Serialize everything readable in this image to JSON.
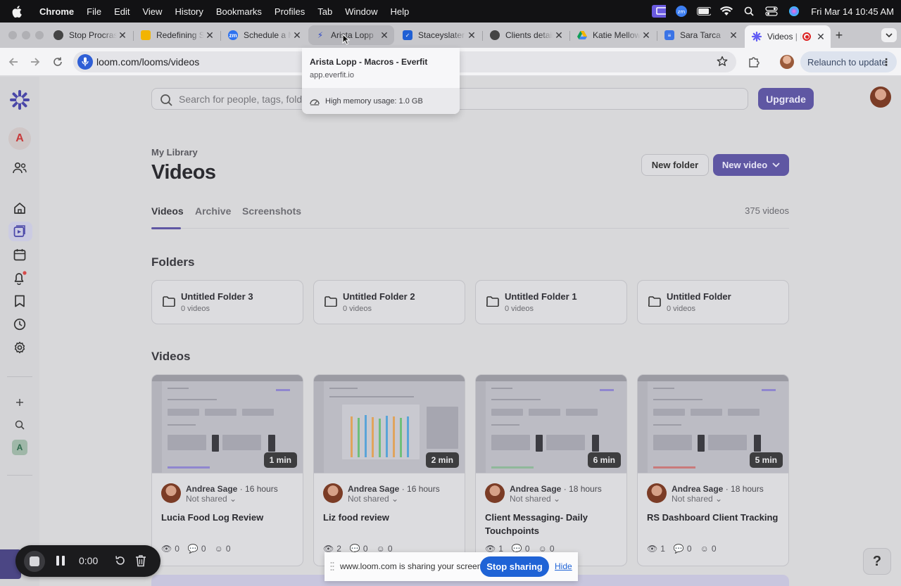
{
  "menubar": {
    "app": "Chrome",
    "items": [
      "File",
      "Edit",
      "View",
      "History",
      "Bookmarks",
      "Profiles",
      "Tab",
      "Window",
      "Help"
    ],
    "clock": "Fri Mar 14  10:45 AM"
  },
  "browser": {
    "tabs": [
      {
        "label": "Stop Procrastinating",
        "favicon": "circle-logo-icon"
      },
      {
        "label": "Redefining Success",
        "favicon": "slides-icon"
      },
      {
        "label": "Schedule a Meeting",
        "favicon": "zoom-icon"
      },
      {
        "label": "Arista Lopp",
        "favicon": "everfit-icon"
      },
      {
        "label": "Staceyslater",
        "favicon": "jira-icon"
      },
      {
        "label": "Clients details",
        "favicon": "circle-logo-icon"
      },
      {
        "label": "Katie Mellow",
        "favicon": "drive-icon"
      },
      {
        "label": "Sara Tarca",
        "favicon": "docs-icon"
      },
      {
        "label": "Videos | Loom",
        "favicon": "loom-icon"
      }
    ],
    "url": "loom.com/looms/videos",
    "relaunch_label": "Relaunch to update"
  },
  "hovercard": {
    "title": "Arista Lopp - Macros - Everfit",
    "host": "app.everfit.io",
    "memory": "High memory usage: 1.0 GB"
  },
  "loom": {
    "search_placeholder": "Search for people, tags, folders, spaces, and Looms",
    "upgrade_label": "Upgrade",
    "workspace_initial": "A",
    "library_label": "My Library",
    "title": "Videos",
    "new_folder_label": "New folder",
    "new_video_label": "New video",
    "tabs": [
      "Videos",
      "Archive",
      "Screenshots"
    ],
    "video_count": "375 videos",
    "folders_heading": "Folders",
    "folders": [
      {
        "name": "Untitled Folder 3",
        "count": "0 videos"
      },
      {
        "name": "Untitled Folder 2",
        "count": "0 videos"
      },
      {
        "name": "Untitled Folder 1",
        "count": "0 videos"
      },
      {
        "name": "Untitled Folder",
        "count": "0 videos"
      }
    ],
    "videos_heading": "Videos",
    "videos": [
      {
        "title": "Lucia Food Log Review",
        "author": "Andrea Sage",
        "age": "16 hours",
        "share": "Not shared",
        "duration": "1 min",
        "views": "0",
        "comments": "0",
        "reactions": "0"
      },
      {
        "title": "Liz food review",
        "author": "Andrea Sage",
        "age": "16 hours",
        "share": "Not shared",
        "duration": "2 min",
        "views": "2",
        "comments": "0",
        "reactions": "0"
      },
      {
        "title": "Client Messaging- Daily Touchpoints",
        "author": "Andrea Sage",
        "age": "18 hours",
        "share": "Not shared",
        "duration": "6 min",
        "views": "1",
        "comments": "0",
        "reactions": "0"
      },
      {
        "title": "RS Dashboard Client Tracking",
        "author": "Andrea Sage",
        "age": "18 hours",
        "share": "Not shared",
        "duration": "5 min",
        "views": "1",
        "comments": "0",
        "reactions": "0"
      }
    ],
    "help_label": "?",
    "workspace_letter_bottom": "A"
  },
  "recorder": {
    "time": "0:00"
  },
  "share_bar": {
    "text": "www.loom.com is sharing your screen.",
    "stop_label": "Stop sharing",
    "hide_label": "Hide"
  },
  "colors": {
    "accent": "#5f57a3",
    "share_blue": "#1f63d6",
    "record_dark": "#1b1b1d"
  }
}
